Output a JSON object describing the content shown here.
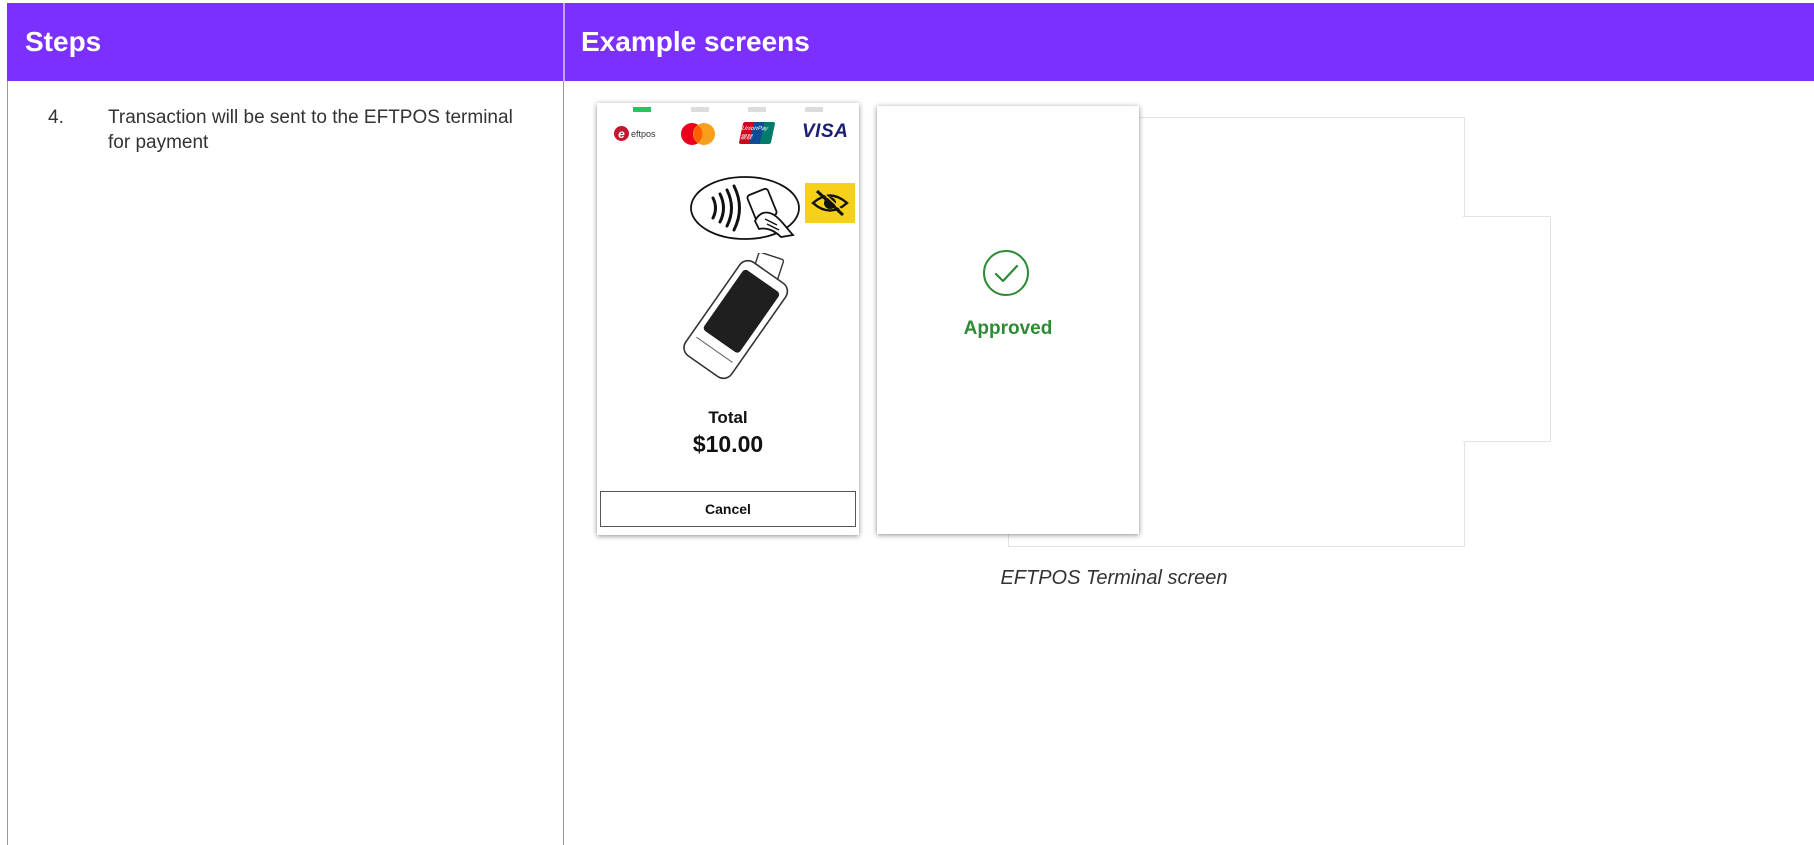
{
  "header": {
    "steps_title": "Steps",
    "examples_title": "Example screens",
    "bg_color": "#7b30ff"
  },
  "step": {
    "number": "4.",
    "text": "Transaction will be sent to the EFTPOS terminal for payment"
  },
  "terminal": {
    "brands": {
      "eftpos": "eftpos",
      "unionpay": "UnionPay 银联",
      "visa": "VISA"
    },
    "total_label": "Total",
    "total_amount": "$10.00",
    "cancel_label": "Cancel",
    "indicator_active_color": "#22c55e"
  },
  "approved": {
    "text": "Approved",
    "color": "#2e8b35",
    "icon": "check-circle-icon"
  },
  "caption": "EFTPOS Terminal screen"
}
